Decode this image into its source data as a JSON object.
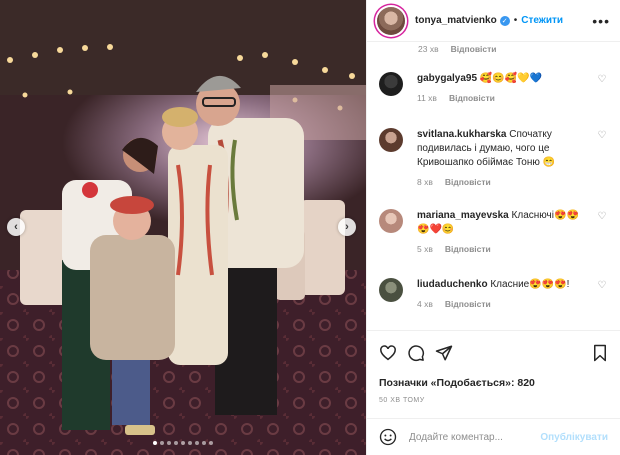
{
  "post": {
    "username": "tonya_matvienko",
    "separator": "•",
    "follow_label": "Стежити",
    "more_label": "•••",
    "carousel_dot_count": 9,
    "carousel_active_index": 0,
    "top_meta": {
      "time": "23 хв",
      "reply": "Відповісти"
    },
    "comments": [
      {
        "user": "gabygalya95",
        "text": "🥰😊🥰💛💙",
        "time": "11 хв",
        "reply": "Відповісти"
      },
      {
        "user": "svitlana.kukharska",
        "text": "Спочатку подивилась і думаю, чого це Кривошапко обіймає Тоню 😁",
        "time": "8 хв",
        "reply": "Відповісти"
      },
      {
        "user": "mariana_mayevska",
        "text": "Класнючі😍😍 😍❤️😊",
        "time": "5 хв",
        "reply": "Відповісти"
      },
      {
        "user": "liudaduchenko",
        "text": "Класние😍😍😍!",
        "time": "4 хв",
        "reply": "Відповісти"
      }
    ],
    "likes_prefix": "Позначки «Подобається»: ",
    "likes_count": "820",
    "posted_ago": "50 ХВ ТОМУ",
    "comment_placeholder": "Додайте коментар...",
    "publish_label": "Опублікувати"
  },
  "colors": {
    "accent": "#0095f6",
    "muted": "#8e8e8e",
    "publish_disabled": "#b2dffc"
  },
  "icons": [
    "chevron-left-icon",
    "chevron-right-icon",
    "more-icon",
    "heart-icon",
    "comment-icon",
    "share-icon",
    "bookmark-icon",
    "emoji-icon",
    "verified-icon"
  ]
}
